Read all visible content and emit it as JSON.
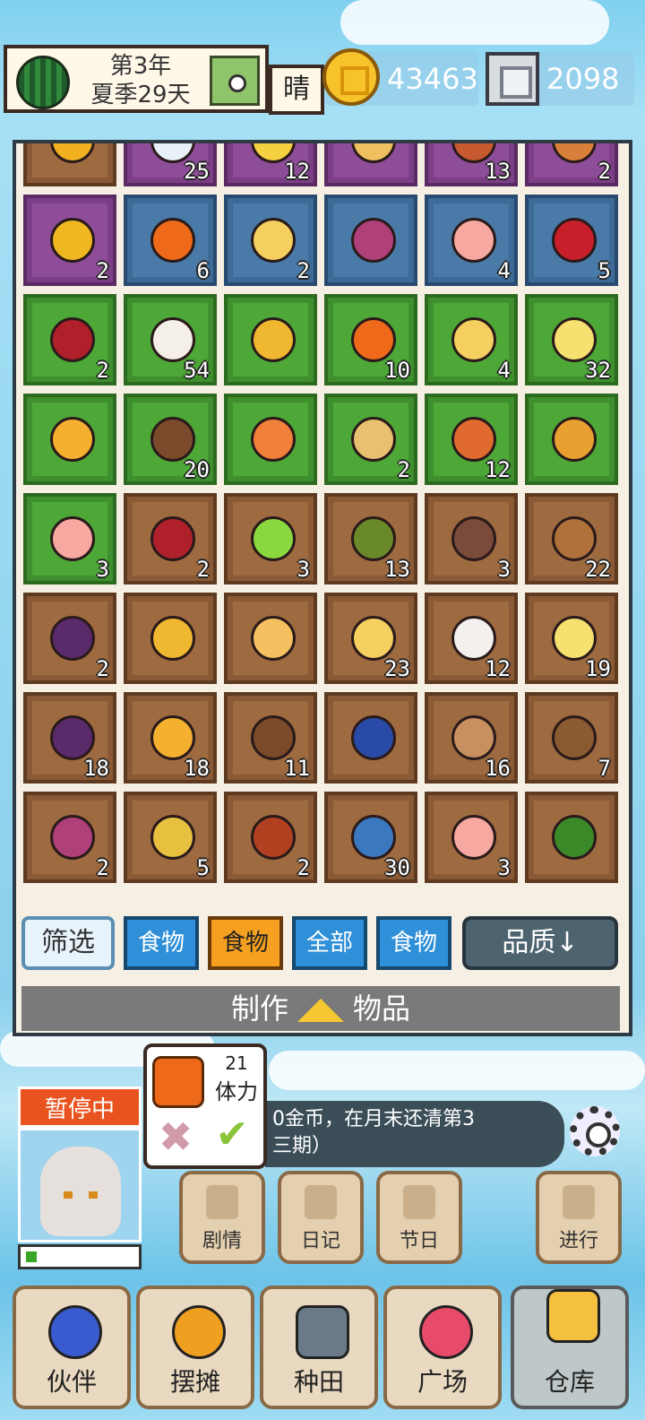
{
  "header": {
    "date_line1": "第3年",
    "date_line2": "夏季29天",
    "weather": "晴",
    "gold": "43463",
    "gems": "2098"
  },
  "inventory": {
    "slots": [
      {
        "q": "q-brown",
        "c": "",
        "icon": "honey-cake-icon",
        "color": "#f0b020"
      },
      {
        "q": "q-purple",
        "c": "25",
        "icon": "milk-bottle-icon",
        "color": "#e8f0f8"
      },
      {
        "q": "q-purple",
        "c": "12",
        "icon": "cheese-icon",
        "color": "#f5d040"
      },
      {
        "q": "q-purple",
        "c": "",
        "icon": "omelette-icon",
        "color": "#f0c060"
      },
      {
        "q": "q-purple",
        "c": "13",
        "icon": "bacon-icon",
        "color": "#c85a30"
      },
      {
        "q": "q-purple",
        "c": "2",
        "icon": "pie-icon",
        "color": "#d8803a"
      },
      {
        "q": "q-purple",
        "c": "2",
        "icon": "honeycomb-icon",
        "color": "#f0b820"
      },
      {
        "q": "q-blue",
        "c": "6",
        "icon": "jam-jar-icon",
        "color": "#ee6a1a"
      },
      {
        "q": "q-blue",
        "c": "2",
        "icon": "pear-icon",
        "color": "#f5d060"
      },
      {
        "q": "q-blue",
        "c": "",
        "icon": "grape-bunch-icon",
        "color": "#b0407a"
      },
      {
        "q": "q-blue",
        "c": "4",
        "icon": "peach-icon",
        "color": "#f7a8a0"
      },
      {
        "q": "q-blue",
        "c": "5",
        "icon": "sake-bottle-icon",
        "color": "#c8202a"
      },
      {
        "q": "q-green",
        "c": "2",
        "icon": "apple-icon",
        "color": "#b0202a"
      },
      {
        "q": "q-green",
        "c": "54",
        "icon": "yogurt-jar-icon",
        "color": "#f4f0e8"
      },
      {
        "q": "q-green",
        "c": "",
        "icon": "pineapple-icon",
        "color": "#f0b830"
      },
      {
        "q": "q-green",
        "c": "10",
        "icon": "jam-jar-icon",
        "color": "#ee6a1a"
      },
      {
        "q": "q-green",
        "c": "4",
        "icon": "pear-icon",
        "color": "#f5d060"
      },
      {
        "q": "q-green",
        "c": "32",
        "icon": "sushi-plate-icon",
        "color": "#f5e070"
      },
      {
        "q": "q-green",
        "c": "",
        "icon": "fried-egg-icon",
        "color": "#f5b030"
      },
      {
        "q": "q-green",
        "c": "20",
        "icon": "skewer-icon",
        "color": "#7a4a2a"
      },
      {
        "q": "q-green",
        "c": "",
        "icon": "orange-icon",
        "color": "#f0803a"
      },
      {
        "q": "q-green",
        "c": "2",
        "icon": "potato-icon",
        "color": "#e8c070"
      },
      {
        "q": "q-green",
        "c": "12",
        "icon": "bacon-icon",
        "color": "#e06a30"
      },
      {
        "q": "q-green",
        "c": "",
        "icon": "mango-icon",
        "color": "#e8a030"
      },
      {
        "q": "q-green",
        "c": "3",
        "icon": "peach-icon",
        "color": "#f7a8a0"
      },
      {
        "q": "q-brown",
        "c": "2",
        "icon": "apple-icon",
        "color": "#b0202a"
      },
      {
        "q": "q-brown",
        "c": "3",
        "icon": "green-slime-icon",
        "color": "#8ad840"
      },
      {
        "q": "q-brown",
        "c": "13",
        "icon": "salad-icon",
        "color": "#6a8a2a"
      },
      {
        "q": "q-brown",
        "c": "3",
        "icon": "lantern-jar-icon",
        "color": "#7a4a3a"
      },
      {
        "q": "q-brown",
        "c": "22",
        "icon": "bread-loaf-icon",
        "color": "#b0703a"
      },
      {
        "q": "q-brown",
        "c": "2",
        "icon": "grapes-icon",
        "color": "#5a2a6a"
      },
      {
        "q": "q-brown",
        "c": "",
        "icon": "pineapple-icon",
        "color": "#f0b830"
      },
      {
        "q": "q-brown",
        "c": "",
        "icon": "cheese-wedge-icon",
        "color": "#f5c060"
      },
      {
        "q": "q-brown",
        "c": "23",
        "icon": "pear-icon",
        "color": "#f5d060"
      },
      {
        "q": "q-brown",
        "c": "12",
        "icon": "dumpling-icon",
        "color": "#f4f0ee"
      },
      {
        "q": "q-brown",
        "c": "19",
        "icon": "sushi-plate-icon",
        "color": "#f5e070"
      },
      {
        "q": "q-brown",
        "c": "18",
        "icon": "plum-icon",
        "color": "#5a2a6a"
      },
      {
        "q": "q-brown",
        "c": "18",
        "icon": "fried-egg-icon",
        "color": "#f5b030"
      },
      {
        "q": "q-brown",
        "c": "11",
        "icon": "skewer-icon",
        "color": "#7a4a2a"
      },
      {
        "q": "q-brown",
        "c": "",
        "icon": "blueberry-icon",
        "color": "#2a4aa8"
      },
      {
        "q": "q-brown",
        "c": "16",
        "icon": "bun-icon",
        "color": "#c89060"
      },
      {
        "q": "q-brown",
        "c": "7",
        "icon": "toast-icon",
        "color": "#8a5a30"
      },
      {
        "q": "q-brown",
        "c": "2",
        "icon": "grape-bunch-icon",
        "color": "#b0407a"
      },
      {
        "q": "q-brown",
        "c": "5",
        "icon": "rice-cake-icon",
        "color": "#e8c040"
      },
      {
        "q": "q-brown",
        "c": "2",
        "icon": "roast-box-icon",
        "color": "#b04020"
      },
      {
        "q": "q-brown",
        "c": "30",
        "icon": "fish-icon",
        "color": "#3a78c0"
      },
      {
        "q": "q-brown",
        "c": "3",
        "icon": "peach-icon",
        "color": "#f7a8a0"
      },
      {
        "q": "q-brown",
        "c": "",
        "icon": "herb-leaves-icon",
        "color": "#3a8a2a"
      }
    ]
  },
  "filters": {
    "filter": "筛选",
    "tab1": "食物",
    "tab2": "食物",
    "tab3": "全部",
    "tab4": "食物",
    "quality": "品质↓"
  },
  "craft": {
    "left": "制作",
    "right": "物品"
  },
  "status": {
    "paused": "暂停中",
    "tip_value": "21",
    "tip_label": "体力",
    "message_line1": "0金币，在月末还清第3",
    "message_line2": "三期）"
  },
  "shortcuts": {
    "story": "剧情",
    "diary": "日记",
    "festival": "节日",
    "proceed": "进行"
  },
  "nav": {
    "partner": "伙伴",
    "stall": "摆摊",
    "farm": "种田",
    "plaza": "广场",
    "warehouse": "仓库"
  },
  "colors": {
    "accent_orange": "#f5a020",
    "tab_blue": "#2f8fd8",
    "paused_red": "#e8531f"
  }
}
